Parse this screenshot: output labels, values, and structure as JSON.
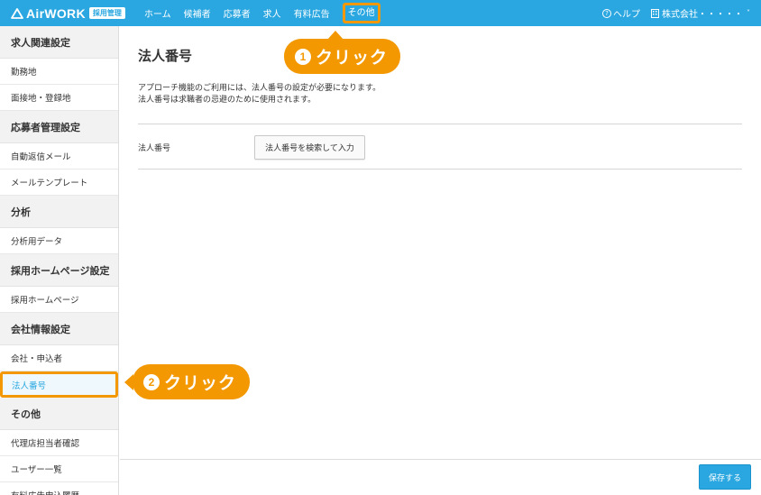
{
  "header": {
    "logo_text": "AirWORK",
    "logo_badge": "採用管理",
    "nav": [
      {
        "label": "ホーム"
      },
      {
        "label": "候補者"
      },
      {
        "label": "応募者"
      },
      {
        "label": "求人"
      },
      {
        "label": "有料広告"
      },
      {
        "label": "その他"
      }
    ],
    "help_label": "ヘルプ",
    "company_label": "株式会社・・・・・",
    "company_caret": "˅"
  },
  "sidebar": {
    "sections": [
      {
        "title": "求人関連設定",
        "items": [
          "勤務地",
          "面接地・登録地"
        ]
      },
      {
        "title": "応募者管理設定",
        "items": [
          "自動返信メール",
          "メールテンプレート"
        ]
      },
      {
        "title": "分析",
        "items": [
          "分析用データ"
        ]
      },
      {
        "title": "採用ホームページ設定",
        "items": [
          "採用ホームページ"
        ]
      },
      {
        "title": "会社情報設定",
        "items": [
          "会社・申込者",
          "法人番号"
        ]
      },
      {
        "title": "その他",
        "items": [
          "代理店担当者確認",
          "ユーザー一覧",
          "有料広告申込履歴"
        ]
      }
    ],
    "active_item": "法人番号"
  },
  "main": {
    "title": "法人番号",
    "desc_line1": "アプローチ機能のご利用には、法人番号の設定が必要になります。",
    "desc_line2": "法人番号は求職者の忌避のために使用されます。",
    "field_label": "法人番号",
    "field_button": "法人番号を検索して入力"
  },
  "footer": {
    "save_label": "保存する"
  },
  "callouts": {
    "one": {
      "num": "1",
      "text": "クリック"
    },
    "two": {
      "num": "2",
      "text": "クリック"
    }
  },
  "colors": {
    "brand": "#2aa7e0",
    "highlight": "#f39800"
  }
}
